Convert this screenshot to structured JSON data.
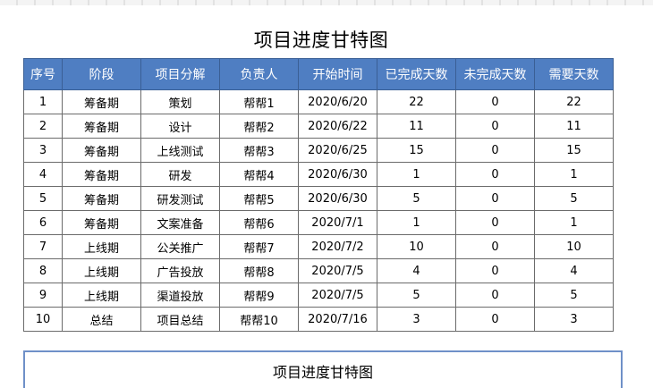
{
  "title": "项目进度甘特图",
  "table": {
    "headers": [
      "序号",
      "阶段",
      "项目分解",
      "负责人",
      "开始时间",
      "已完成天数",
      "未完成天数",
      "需要天数"
    ],
    "rows": [
      [
        "1",
        "筹备期",
        "策划",
        "帮帮1",
        "2020/6/20",
        "22",
        "0",
        "22"
      ],
      [
        "2",
        "筹备期",
        "设计",
        "帮帮2",
        "2020/6/22",
        "11",
        "0",
        "11"
      ],
      [
        "3",
        "筹备期",
        "上线测试",
        "帮帮3",
        "2020/6/25",
        "15",
        "0",
        "15"
      ],
      [
        "4",
        "筹备期",
        "研发",
        "帮帮4",
        "2020/6/30",
        "1",
        "0",
        "1"
      ],
      [
        "5",
        "筹备期",
        "研发测试",
        "帮帮5",
        "2020/6/30",
        "5",
        "0",
        "5"
      ],
      [
        "6",
        "筹备期",
        "文案准备",
        "帮帮6",
        "2020/7/1",
        "1",
        "0",
        "1"
      ],
      [
        "7",
        "上线期",
        "公关推广",
        "帮帮7",
        "2020/7/2",
        "10",
        "0",
        "10"
      ],
      [
        "8",
        "上线期",
        "广告投放",
        "帮帮8",
        "2020/7/5",
        "4",
        "0",
        "4"
      ],
      [
        "9",
        "上线期",
        "渠道投放",
        "帮帮9",
        "2020/7/5",
        "5",
        "0",
        "5"
      ],
      [
        "10",
        "总结",
        "项目总结",
        "帮帮10",
        "2020/7/16",
        "3",
        "0",
        "3"
      ]
    ]
  },
  "chart_panel": {
    "title": "项目进度甘特图"
  }
}
